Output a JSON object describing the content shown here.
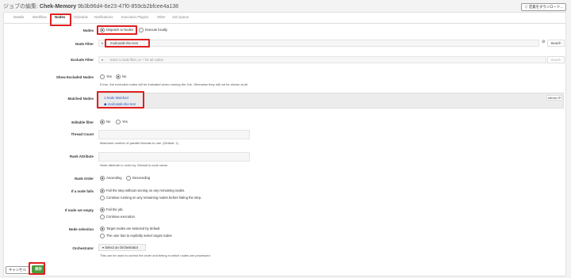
{
  "header": {
    "prefix": "ジョブの編集:",
    "job_name": "Chek-Memory",
    "job_id": "9b3b96d4-6e23-47f0-859cb2bfcee4a138",
    "download_label": "⇩ 定義をダウンロード..."
  },
  "tabs": [
    "Details",
    "Workflow",
    "Nodes",
    "Schedule",
    "Notifications",
    "Execution Plugins",
    "Other",
    "Job Queue"
  ],
  "nodes_section": {
    "dispatch_label": "Nodes",
    "dispatch_option": "Dispatch to Nodes",
    "execute_option": "Execute locally",
    "node_filter_label": "Node Filter",
    "node_filter_value": "mailcutalk-rike-test",
    "search_label": "Search",
    "exclude_filter_label": "Exclude Filter",
    "exclude_filter_placeholder": "Enter a node filter, or .* for all nodes",
    "show_excluded_label": "Show Excluded Nodes",
    "yes": "Yes",
    "no": "No",
    "show_excluded_help": "If true, the excluded nodes will be indicated when running the Job. Otherwise they will not be shown at all.",
    "matched_label": "Matched Nodes",
    "matched_count": "1 Node Matched",
    "matched_node": "mailcutalk-rike-test",
    "refresh_label": "refresh",
    "editable_label": "Editable filter",
    "thread_label": "Thread Count",
    "thread_help": "Maximum number of parallel threads to use. (Default: 1)",
    "rank_attr_label": "Rank Attribute",
    "rank_attr_help": "Node attribute to order by. Default is node name.",
    "rank_order_label": "Rank Order",
    "ascending": "Ascending",
    "descending": "Descending",
    "fail_label": "If a node fails",
    "fail_opt1": "Fail the step without running on any remaining nodes.",
    "fail_opt2": "Continue running on any remaining nodes before failing the step.",
    "empty_label": "If node set empty",
    "empty_opt1": "Fail the job.",
    "empty_opt2": "Continue execution.",
    "selection_label": "Node selection",
    "selection_opt1": "Target nodes are selected by default",
    "selection_opt2": "The user has to explicitly select target nodes",
    "orchestrator_label": "Orchestrator",
    "orchestrator_select": "Select an Orchestrator",
    "orchestrator_help": "This can be used to control the order and timing in which nodes are processed"
  },
  "footer": {
    "cancel": "キャンセル",
    "save": "保存"
  },
  "colors": {
    "highlight": "#e02020",
    "save": "#4a9a3e",
    "link": "#2a56c6"
  }
}
